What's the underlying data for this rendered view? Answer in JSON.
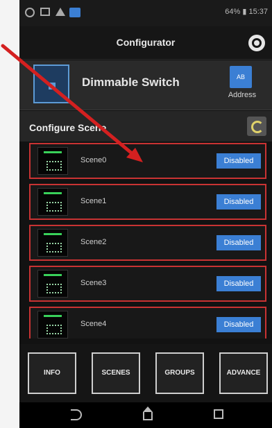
{
  "status_bar": {
    "battery_time": "64% ▮ 15:37"
  },
  "app_bar": {
    "title": "Configurator"
  },
  "device": {
    "name": "Dimmable Switch",
    "address_button": "AB",
    "address_label": "Address"
  },
  "section": {
    "title": "Configure Scene"
  },
  "scenes": [
    {
      "name": "Scene0",
      "status": "Disabled"
    },
    {
      "name": "Scene1",
      "status": "Disabled"
    },
    {
      "name": "Scene2",
      "status": "Disabled"
    },
    {
      "name": "Scene3",
      "status": "Disabled"
    },
    {
      "name": "Scene4",
      "status": "Disabled"
    }
  ],
  "tabs": [
    {
      "label": "INFO"
    },
    {
      "label": "SCENES"
    },
    {
      "label": "GROUPS"
    },
    {
      "label": "ADVANCE"
    }
  ],
  "colors": {
    "accent": "#3b7fd4",
    "highlight_border": "#c93333",
    "arrow": "#d42020"
  }
}
